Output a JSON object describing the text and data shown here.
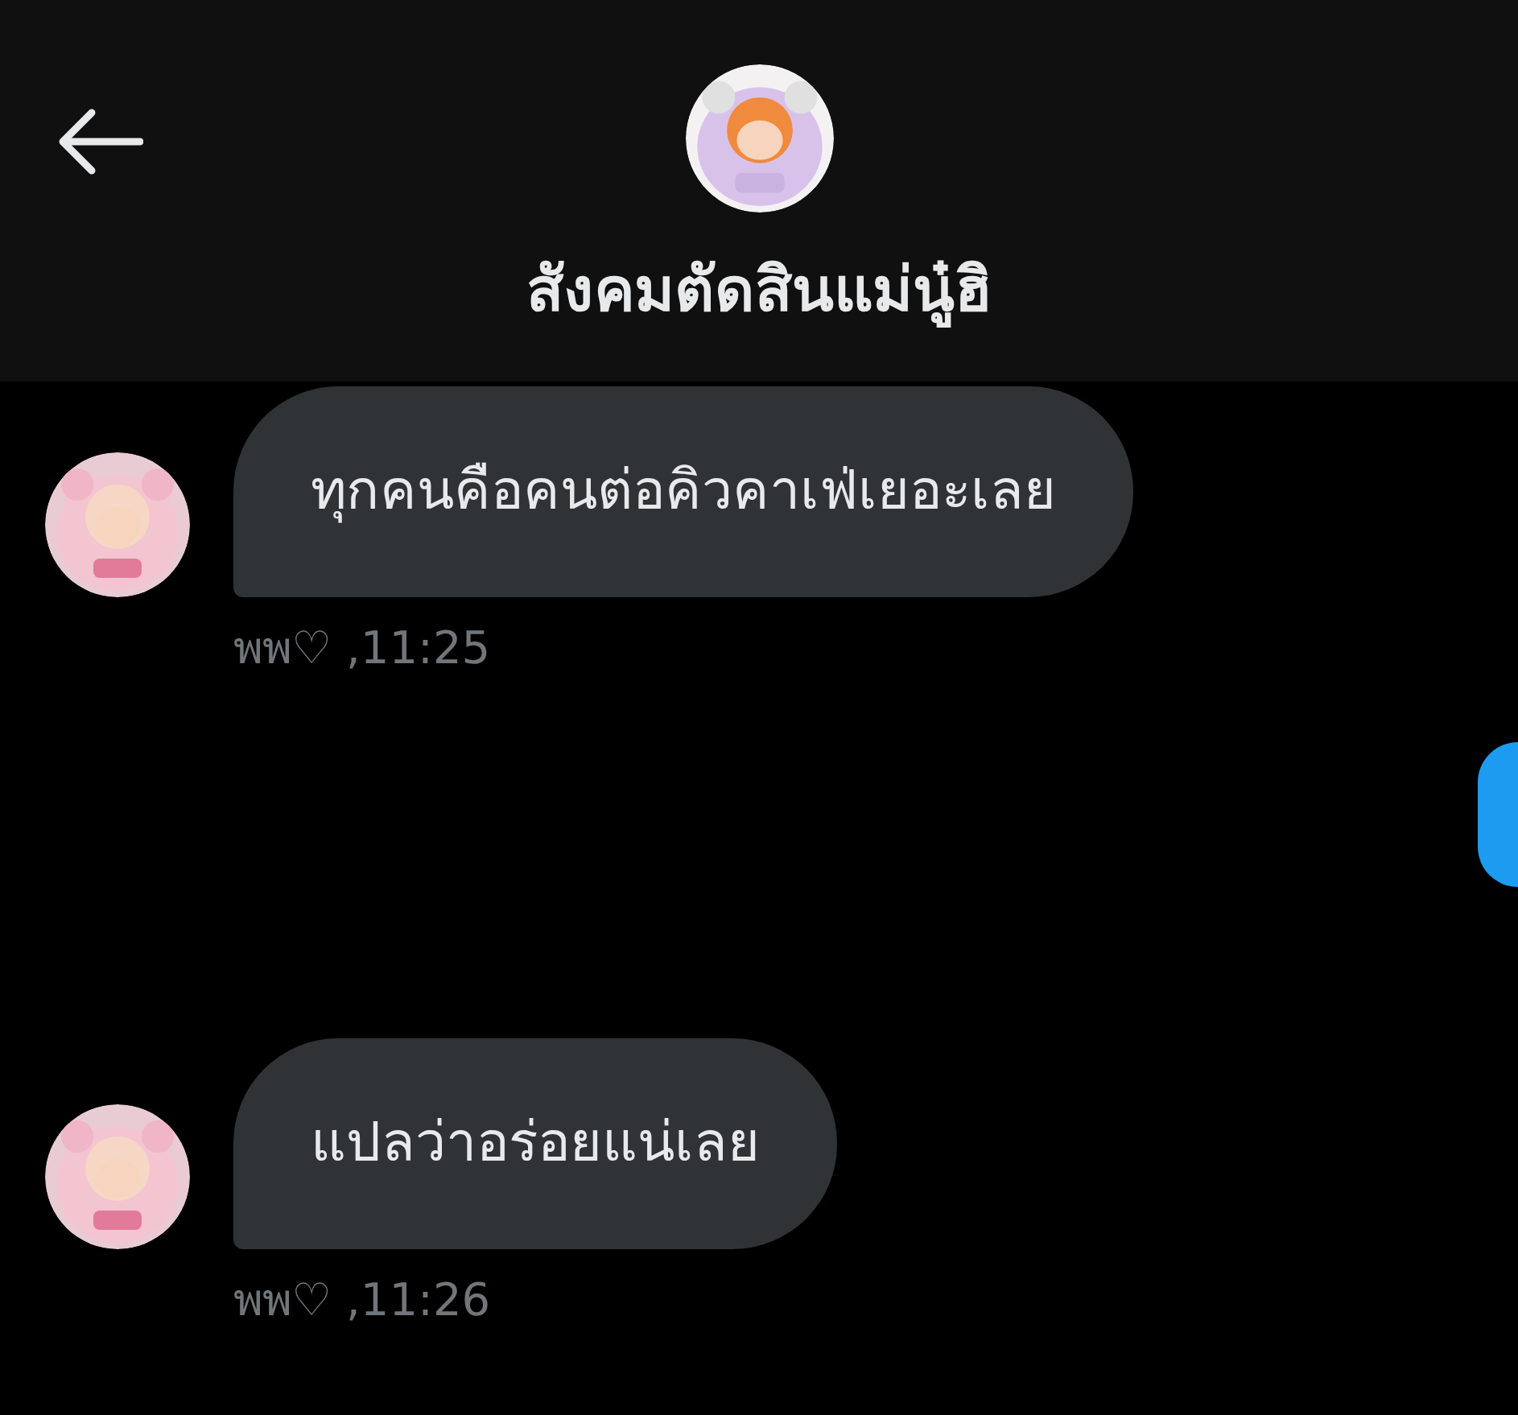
{
  "header": {
    "title": "สังคมตัดสินแม่นู๋ฮิ"
  },
  "messages": [
    {
      "kind": "received",
      "text": "ทุกคนคือคนต่อคิวคาเฟ่เยอะเลย",
      "meta": "พพ♡ ,11:25"
    },
    {
      "kind": "sent"
    },
    {
      "kind": "received",
      "text": "แปลว่าอร่อยแน่เลย",
      "meta": "พพ♡ ,11:26"
    }
  ]
}
